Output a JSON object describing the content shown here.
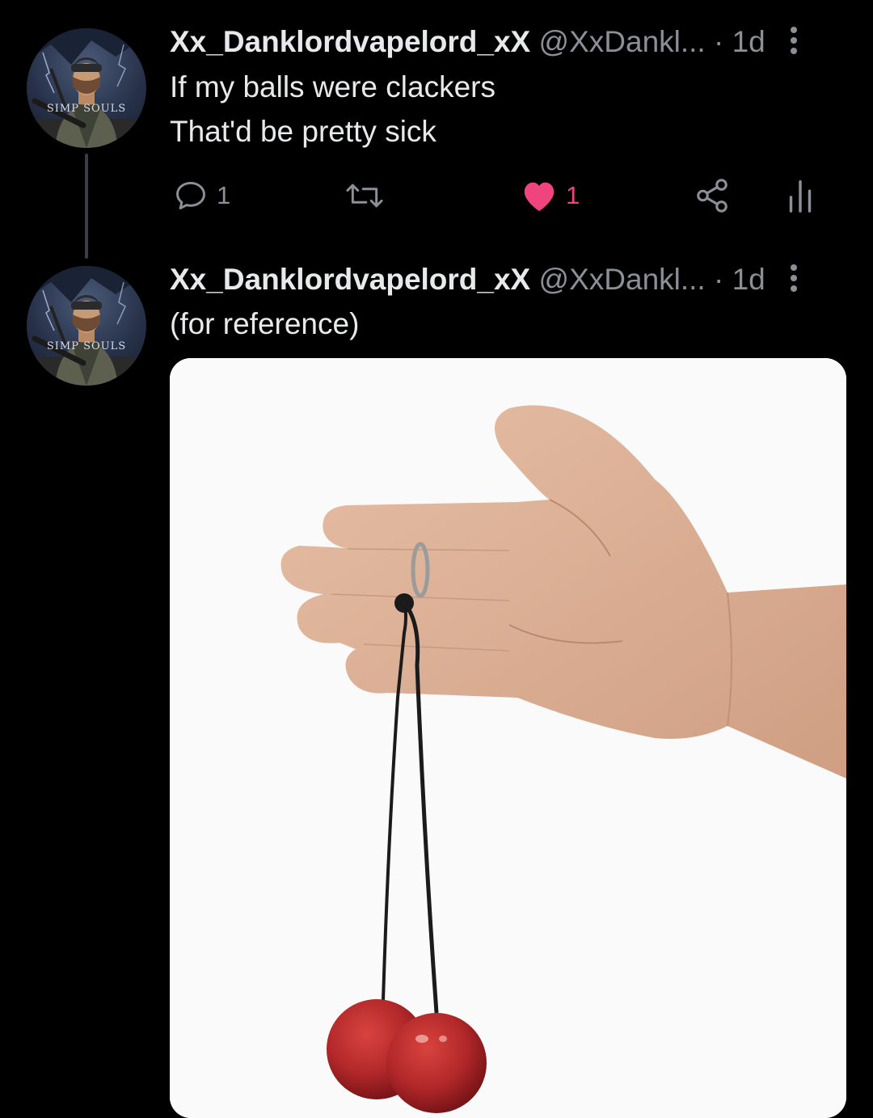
{
  "tweets": [
    {
      "display_name": "Xx_Danklordvapelord_xX",
      "handle": "@XxDankl...",
      "separator": "·",
      "time": "1d",
      "avatar_text": "SIMP SOULS",
      "text_lines": [
        "If my balls were clackers",
        "That'd be pretty sick"
      ],
      "actions": {
        "reply_count": "1",
        "retweet_count": "",
        "like_count": "1",
        "liked": true
      }
    },
    {
      "display_name": "Xx_Danklordvapelord_xX",
      "handle": "@XxDankl...",
      "separator": "·",
      "time": "1d",
      "avatar_text": "SIMP SOULS",
      "text_lines": [
        "(for reference)"
      ],
      "media": {
        "icons": [
          "hand",
          "clacker-balls"
        ]
      }
    }
  ],
  "colors": {
    "background": "#000000",
    "text_primary": "#e7e9ea",
    "text_secondary": "#8b9096",
    "like_pink": "#f0447f",
    "thread_line": "#3a3e42",
    "clacker_red": "#b3282a"
  },
  "icons": {
    "reply": "speech-bubble-icon",
    "retweet": "retweet-arrows-icon",
    "like": "heart-icon",
    "share": "share-nodes-icon",
    "views": "bar-chart-icon",
    "more": "vertical-ellipsis-icon"
  }
}
